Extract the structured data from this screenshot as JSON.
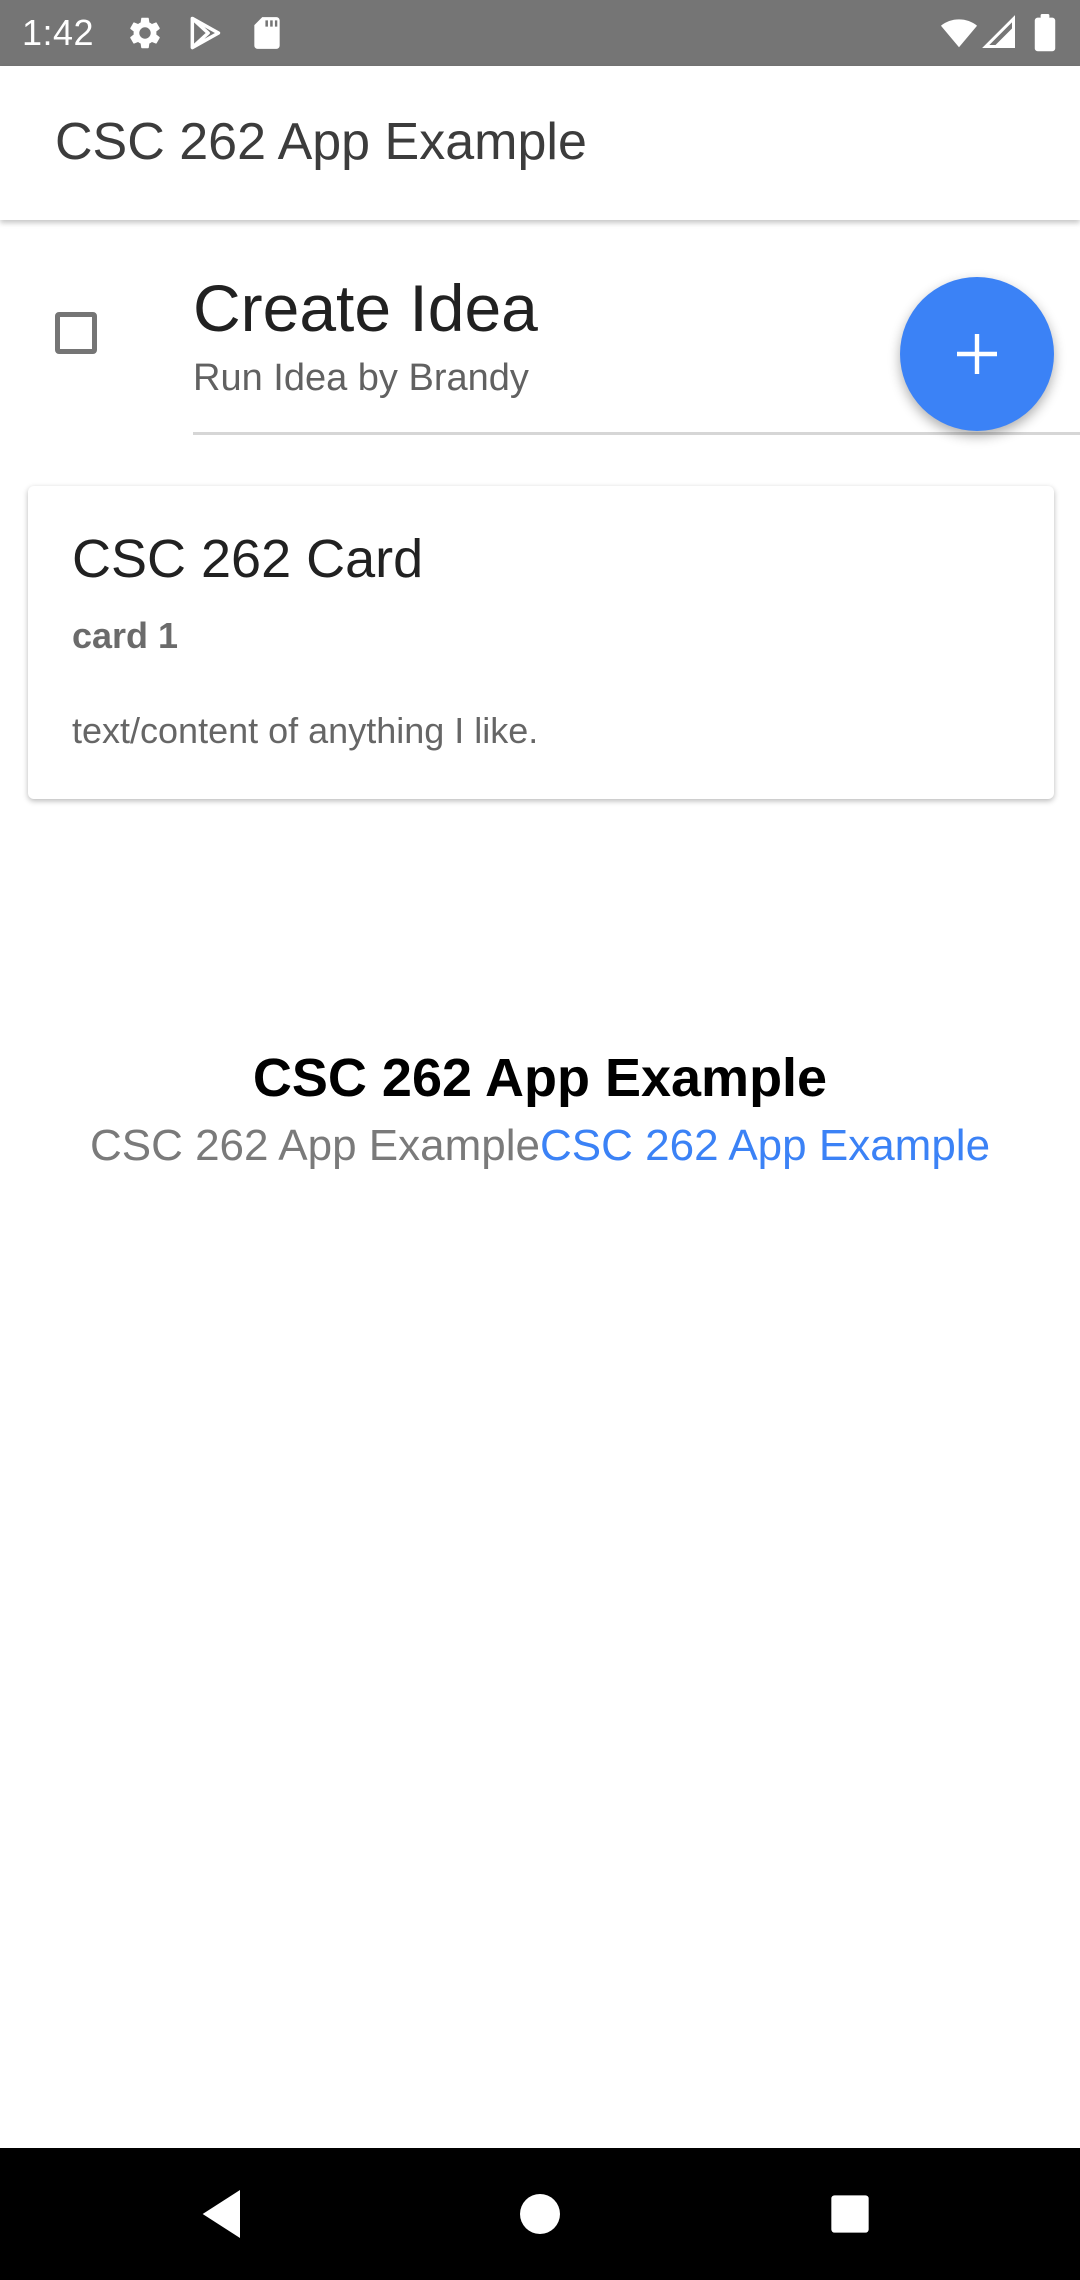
{
  "status_bar": {
    "time": "1:42",
    "left_icons": [
      "gear-icon",
      "play-store-icon",
      "sd-card-icon"
    ],
    "right_icons": [
      "wifi-icon",
      "signal-icon",
      "battery-icon"
    ]
  },
  "app_bar": {
    "title": "CSC 262 App Example"
  },
  "list_item": {
    "title": "Create Idea",
    "subtitle": "Run Idea by Brandy",
    "checked": false
  },
  "fab": {
    "icon": "plus-icon",
    "color": "#3b82f6"
  },
  "card": {
    "title": "CSC 262 Card",
    "subtitle": "card 1",
    "content": "text/content of anything I like."
  },
  "center": {
    "heading": "CSC 262 App Example",
    "text_gray": "CSC 262 App Example",
    "text_blue": "CSC 262 App Example"
  },
  "colors": {
    "status_bar": "#757575",
    "accent": "#3b82f6",
    "nav_bar": "#000000"
  },
  "nav_bar": {
    "buttons": [
      "back-icon",
      "home-icon",
      "recents-icon"
    ]
  }
}
